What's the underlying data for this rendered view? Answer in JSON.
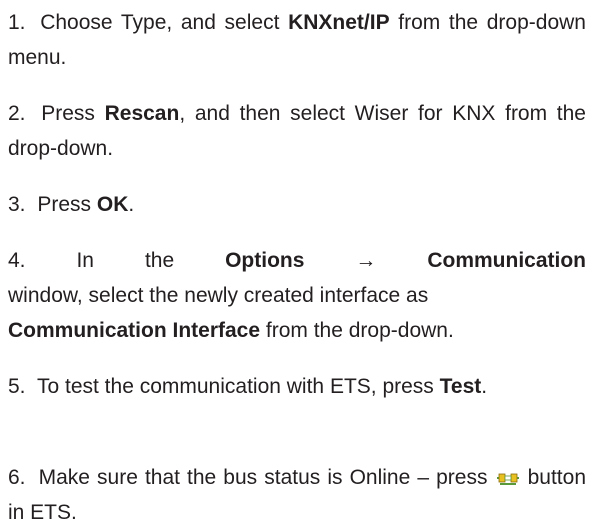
{
  "steps": [
    {
      "number": "1.",
      "before": "Choose Type, and select ",
      "bold": "KNXnet/IP",
      "after": " from the drop-down menu."
    },
    {
      "number": "2.",
      "before": "Press ",
      "bold": "Rescan",
      "after": ", and then select Wiser for KNX from the drop-down."
    },
    {
      "number": "3.",
      "before": "Press ",
      "bold": "OK",
      "after": "."
    },
    {
      "number": "4.",
      "word1": "In",
      "word2": "the",
      "bold1": "Options",
      "arrow": "→",
      "bold2": "Communication",
      "line2": "window, select the newly created interface as",
      "bold3": "Communication Interface",
      "after": " from the drop-down."
    },
    {
      "number": "5.",
      "before": "To test the communication with ETS, press ",
      "bold": "Test",
      "after": "."
    },
    {
      "number": "6.",
      "before": "Make sure that the bus status is Online – press ",
      "icon": "bus-connect-icon",
      "after": " button in ETS."
    }
  ],
  "colors": {
    "text": "#231f20",
    "icon_green": "#5a9a3a",
    "icon_yellow": "#e8c020"
  }
}
